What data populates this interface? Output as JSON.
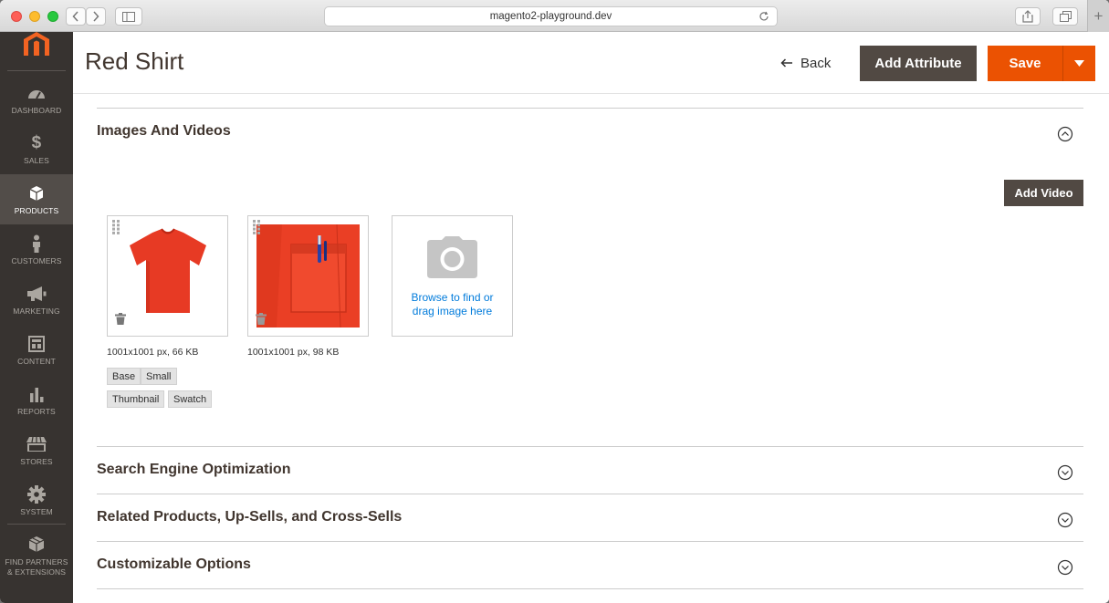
{
  "browser": {
    "url": "magento2-playground.dev",
    "new_tab_label": "+"
  },
  "sidebar": {
    "items": [
      {
        "label": "Dashboard",
        "icon": "dashboard-icon"
      },
      {
        "label": "Sales",
        "icon": "dollar-icon"
      },
      {
        "label": "Products",
        "icon": "box-icon",
        "active": true
      },
      {
        "label": "Customers",
        "icon": "person-icon"
      },
      {
        "label": "Marketing",
        "icon": "megaphone-icon"
      },
      {
        "label": "Content",
        "icon": "layout-icon"
      },
      {
        "label": "Reports",
        "icon": "bar-chart-icon"
      },
      {
        "label": "Stores",
        "icon": "store-icon"
      },
      {
        "label": "System",
        "icon": "gear-icon"
      },
      {
        "label_line1": "Find Partners",
        "label_line2": "& Extensions",
        "icon": "cube-icon"
      }
    ]
  },
  "header": {
    "title": "Red Shirt",
    "back_label": "Back",
    "add_attribute_label": "Add Attribute",
    "save_label": "Save"
  },
  "images_section": {
    "title": "Images And Videos",
    "add_video_label": "Add Video",
    "images": [
      {
        "meta": "1001x1001 px, 66 KB",
        "roles": [
          "Base",
          "Small",
          "Thumbnail",
          "Swatch"
        ]
      },
      {
        "meta": "1001x1001 px, 98 KB",
        "roles": []
      }
    ],
    "upload": {
      "line1": "Browse to find or",
      "line2": "drag image here"
    }
  },
  "sections": [
    {
      "title": "Search Engine Optimization"
    },
    {
      "title": "Related Products, Up-Sells, and Cross-Sells"
    },
    {
      "title": "Customizable Options"
    }
  ],
  "colors": {
    "accent": "#eb5202",
    "dark_button": "#514943",
    "sidebar": "#373330",
    "link": "#007bdb"
  }
}
